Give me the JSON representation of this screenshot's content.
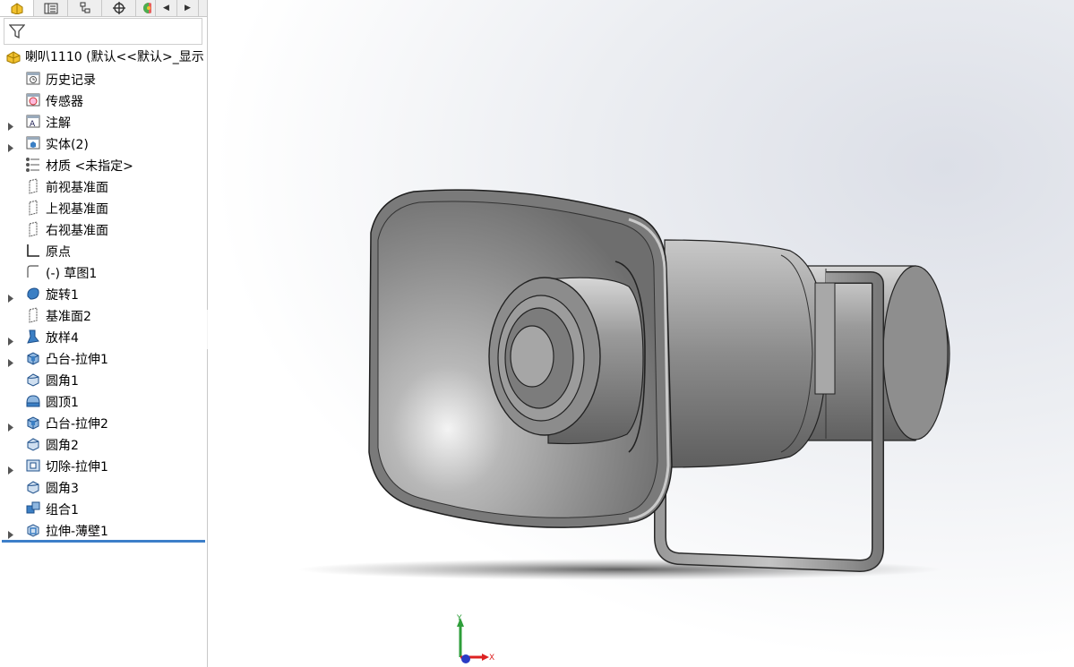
{
  "panel": {
    "tabs": [
      {
        "icon": "featuremanager-icon",
        "active": true
      },
      {
        "icon": "propertymanager-icon"
      },
      {
        "icon": "configurationmanager-icon"
      },
      {
        "icon": "dimxpert-icon"
      },
      {
        "icon": "display-manager-icon"
      }
    ],
    "filter_icon": "filter-icon",
    "root": {
      "label": "喇叭1110  (默认<<默认>_显示"
    },
    "items": [
      {
        "label": "历史记录",
        "icon": "history-icon",
        "expandable": false
      },
      {
        "label": "传感器",
        "icon": "sensors-icon",
        "expandable": false
      },
      {
        "label": "注解",
        "icon": "annotations-icon",
        "expandable": true
      },
      {
        "label": "实体(2)",
        "icon": "solid-bodies-icon",
        "expandable": true
      },
      {
        "label": "材质 <未指定>",
        "icon": "material-icon",
        "expandable": false
      },
      {
        "label": "前视基准面",
        "icon": "plane-icon",
        "expandable": false
      },
      {
        "label": "上视基准面",
        "icon": "plane-icon",
        "expandable": false
      },
      {
        "label": "右视基准面",
        "icon": "plane-icon",
        "expandable": false
      },
      {
        "label": "原点",
        "icon": "origin-icon",
        "expandable": false
      },
      {
        "label": "(-) 草图1",
        "icon": "sketch-icon",
        "expandable": false
      },
      {
        "label": "旋转1",
        "icon": "revolve-icon",
        "expandable": true
      },
      {
        "label": "基准面2",
        "icon": "plane-icon",
        "expandable": false
      },
      {
        "label": "放样4",
        "icon": "loft-icon",
        "expandable": true
      },
      {
        "label": "凸台-拉伸1",
        "icon": "boss-extrude-icon",
        "expandable": true
      },
      {
        "label": "圆角1",
        "icon": "fillet-icon",
        "expandable": false
      },
      {
        "label": "圆顶1",
        "icon": "dome-icon",
        "expandable": false
      },
      {
        "label": "凸台-拉伸2",
        "icon": "boss-extrude-icon",
        "expandable": true
      },
      {
        "label": "圆角2",
        "icon": "fillet-icon",
        "expandable": false
      },
      {
        "label": "切除-拉伸1",
        "icon": "cut-extrude-icon",
        "expandable": true
      },
      {
        "label": "圆角3",
        "icon": "fillet-icon",
        "expandable": false
      },
      {
        "label": "组合1",
        "icon": "combine-icon",
        "expandable": false
      },
      {
        "label": "拉伸-薄壁1",
        "icon": "thin-extrude-icon",
        "expandable": true
      }
    ]
  },
  "viewport": {
    "model": "horn-speaker-model",
    "triad": {
      "y_label": "Y",
      "x_label": "X"
    }
  },
  "colors": {
    "accent": "#3d7fc9",
    "model_gray": "#8a8a8a",
    "viewport_gradient": "#dcdfe7"
  }
}
